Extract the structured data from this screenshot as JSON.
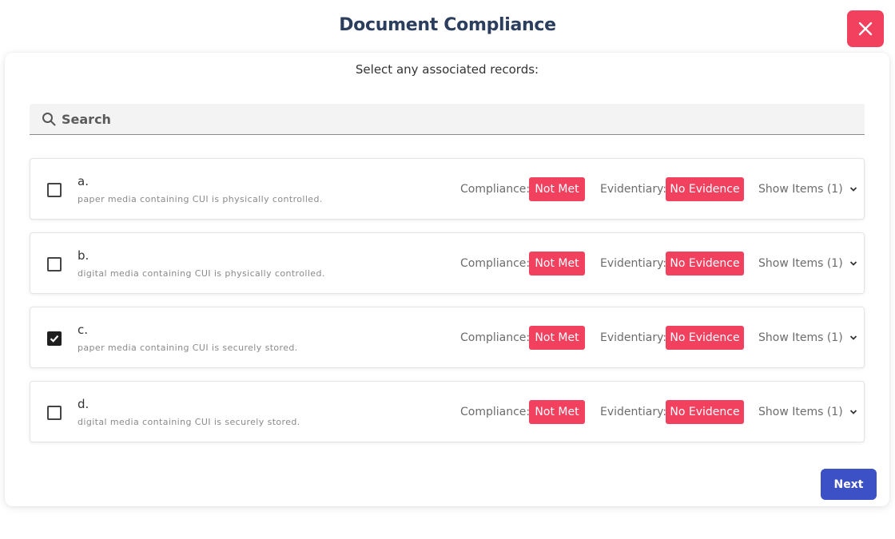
{
  "header": {
    "title": "Document Compliance",
    "close_icon": "close-icon"
  },
  "panel": {
    "subtitle": "Select any associated records:",
    "search": {
      "placeholder": "Search",
      "value": "",
      "icon": "search-icon"
    },
    "records": [
      {
        "letter": "a.",
        "description": "paper media containing CUI is physically controlled.",
        "checked": false,
        "compliance_label": "Compliance:",
        "compliance_status": "Not Met",
        "evidentiary_label": "Evidentiary:",
        "evidentiary_status": "No Evidence",
        "show_items": "Show Items (1)"
      },
      {
        "letter": "b.",
        "description": "digital media containing CUI is physically controlled.",
        "checked": false,
        "compliance_label": "Compliance:",
        "compliance_status": "Not Met",
        "evidentiary_label": "Evidentiary:",
        "evidentiary_status": "No Evidence",
        "show_items": "Show Items (1)"
      },
      {
        "letter": "c.",
        "description": "paper media containing CUI is securely stored.",
        "checked": true,
        "compliance_label": "Compliance:",
        "compliance_status": "Not Met",
        "evidentiary_label": "Evidentiary:",
        "evidentiary_status": "No Evidence",
        "show_items": "Show Items (1)"
      },
      {
        "letter": "d.",
        "description": "digital media containing CUI is securely stored.",
        "checked": false,
        "compliance_label": "Compliance:",
        "compliance_status": "Not Met",
        "evidentiary_label": "Evidentiary:",
        "evidentiary_status": "No Evidence",
        "show_items": "Show Items (1)"
      }
    ],
    "next_label": "Next"
  },
  "colors": {
    "title": "#2c3e5d",
    "danger": "#f2405f",
    "primary_button": "#3d51c7"
  }
}
